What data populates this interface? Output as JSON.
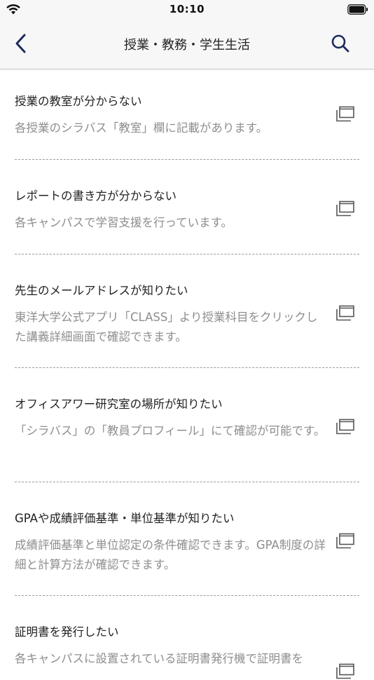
{
  "status_bar": {
    "time": "10:10",
    "icons": [
      "wifi-icon",
      "battery-icon"
    ]
  },
  "nav": {
    "title": "授業・教務・学生生活",
    "back_icon": "chevron-left-icon",
    "search_icon": "search-icon",
    "accent_color": "#1e2a5e"
  },
  "faq_items": [
    {
      "question": "授業の教室が分からない",
      "answer": "各授業のシラバス「教室」欄に記載があります。",
      "icon": "open-window-icon"
    },
    {
      "question": "レポートの書き方が分からない",
      "answer": "各キャンパスで学習支援を行っています。",
      "icon": "open-window-icon"
    },
    {
      "question": "先生のメールアドレスが知りたい",
      "answer": "東洋大学公式アプリ「CLASS」より授業科目をクリックした講義詳細画面で確認できます。",
      "icon": "open-window-icon"
    },
    {
      "question": "オフィスアワー研究室の場所が知りたい",
      "answer": "「シラバス」の「教員プロフィール」にて確認が可能です。",
      "icon": "open-window-icon"
    },
    {
      "question": "GPAや成績評価基準・単位基準が知りたい",
      "answer": "成績評価基準と単位認定の条件確認できます。GPA制度の詳細と計算方法が確認できます。",
      "icon": "open-window-icon"
    },
    {
      "question": "証明書を発行したい",
      "answer": "各キャンパスに設置されている証明書発行機で証明書を",
      "icon": "open-window-icon"
    }
  ]
}
